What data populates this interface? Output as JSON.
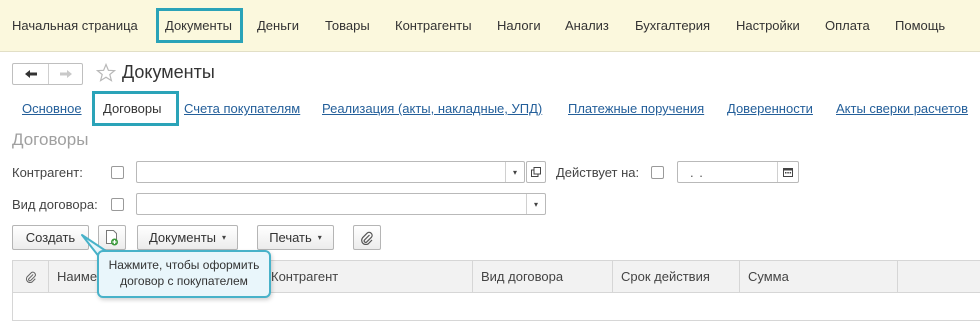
{
  "top_menu": {
    "items": [
      "Начальная страница",
      "Документы",
      "Деньги",
      "Товары",
      "Контрагенты",
      "Налоги",
      "Анализ",
      "Бухгалтерия",
      "Настройки",
      "Оплата",
      "Помощь"
    ],
    "active": "Документы"
  },
  "header": {
    "title": "Документы",
    "back_icon": "arrow-left-icon",
    "forward_icon": "arrow-right-icon",
    "favorite_icon": "star-icon"
  },
  "tabs": {
    "items": [
      "Основное",
      "Договоры",
      "Счета покупателям",
      "Реализация (акты, накладные, УПД)",
      "Платежные поручения",
      "Доверенности",
      "Акты сверки расчетов"
    ],
    "active": "Договоры"
  },
  "section_title": "Договоры",
  "filters": {
    "counterparty_label": "Контрагент:",
    "counterparty_value": "",
    "valid_on_label": "Действует на:",
    "valid_on_value": ". .",
    "contract_type_label": "Вид договора:",
    "contract_type_value": ""
  },
  "toolbar": {
    "create_label": "Создать",
    "documents_label": "Документы",
    "print_label": "Печать"
  },
  "table": {
    "columns": [
      "Наименование",
      "Контрагент",
      "Вид договора",
      "Срок действия",
      "Сумма"
    ]
  },
  "tooltip": {
    "line1": "Нажмите, чтобы оформить",
    "line2": "договор с покупателем"
  },
  "colors": {
    "highlight": "#2aa3b8",
    "link": "#245f9a",
    "menu_bg": "#fbf8dd",
    "tooltip_bg": "#e9f6fb"
  }
}
